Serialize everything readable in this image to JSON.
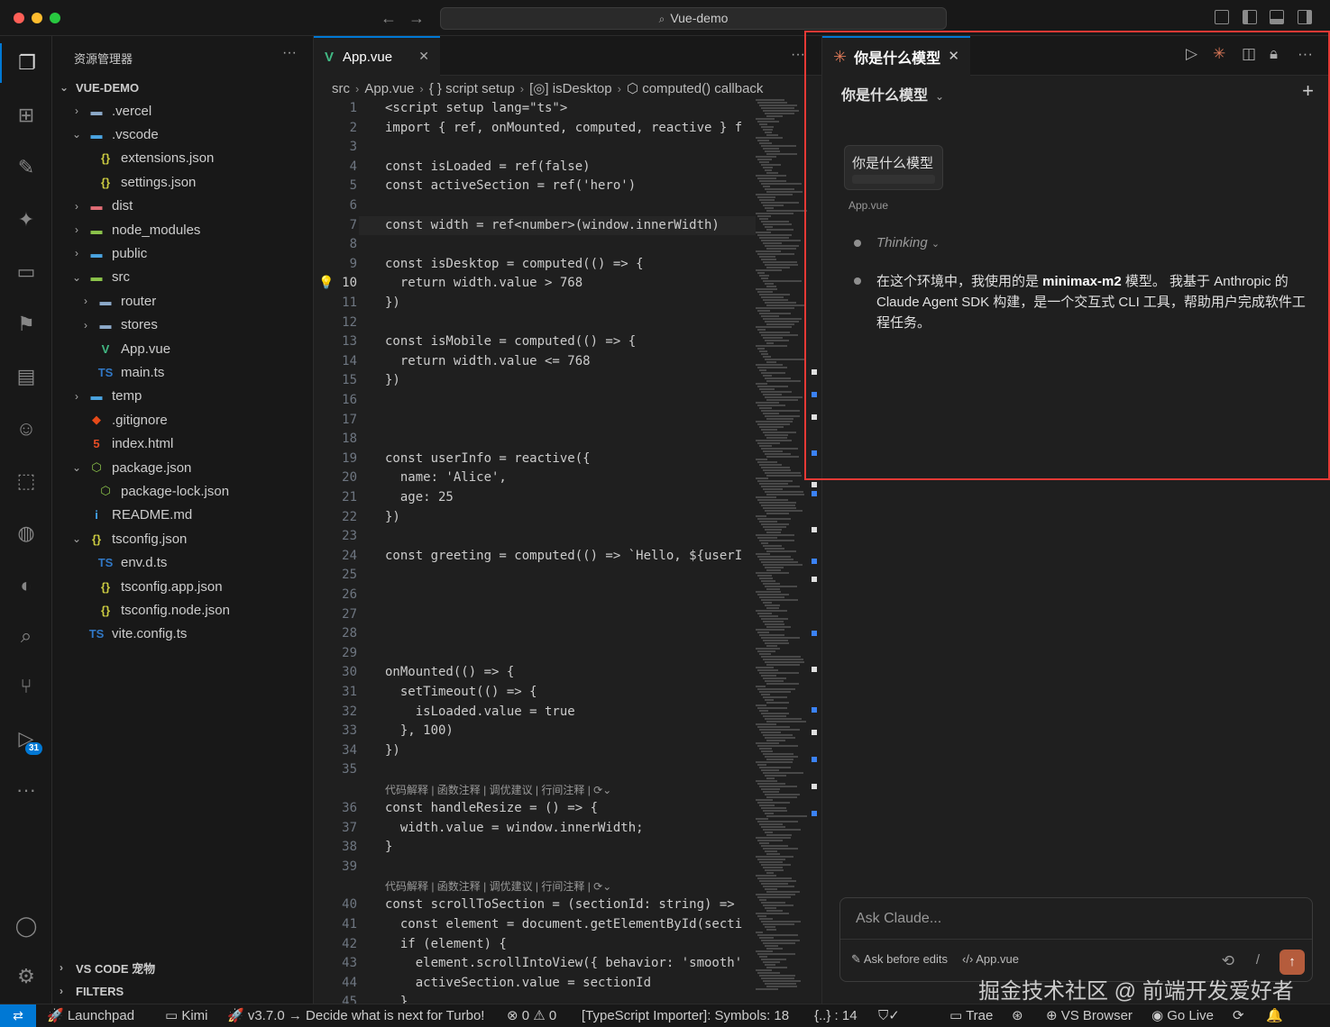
{
  "window": {
    "title": "Vue-demo"
  },
  "colors": {
    "accent": "#0078d4",
    "claude": "#d97757",
    "annotation_box": "#e53935",
    "vue_green": "#41b883"
  },
  "activity_bar": {
    "icons": [
      "explorer-icon",
      "extensions-icon",
      "paint-icon",
      "sparkle-icon",
      "remote-icon",
      "bookmark-icon",
      "notebook-icon",
      "copilot-icon",
      "container-icon",
      "python-icon",
      "github-icon",
      "search-icon",
      "source-control-icon",
      "run-debug-icon",
      "more-icon",
      "account-icon",
      "settings-icon"
    ],
    "badge": "31"
  },
  "sidebar": {
    "title": "资源管理器",
    "more": "···",
    "root": "VUE-DEMO",
    "items": [
      {
        "label": ".vercel",
        "chev": "›",
        "icon": "▬",
        "color": "#8ca9c9",
        "indent": 1
      },
      {
        "label": ".vscode",
        "chev": "⌄",
        "icon": "▬",
        "color": "#4aa3e0",
        "indent": 1
      },
      {
        "label": "extensions.json",
        "chev": "",
        "icon": "{}",
        "color": "#cbcb41",
        "indent": 2
      },
      {
        "label": "settings.json",
        "chev": "",
        "icon": "{}",
        "color": "#cbcb41",
        "indent": 2
      },
      {
        "label": "dist",
        "chev": "›",
        "icon": "▬",
        "color": "#e06c75",
        "indent": 1
      },
      {
        "label": "node_modules",
        "chev": "›",
        "icon": "▬",
        "color": "#8bc34a",
        "indent": 1
      },
      {
        "label": "public",
        "chev": "›",
        "icon": "▬",
        "color": "#4aa3e0",
        "indent": 1
      },
      {
        "label": "src",
        "chev": "⌄",
        "icon": "▬",
        "color": "#8bc34a",
        "indent": 1
      },
      {
        "label": "router",
        "chev": "›",
        "icon": "▬",
        "color": "#8ca9c9",
        "indent": 2
      },
      {
        "label": "stores",
        "chev": "›",
        "icon": "▬",
        "color": "#8ca9c9",
        "indent": 2
      },
      {
        "label": "App.vue",
        "chev": "",
        "icon": "V",
        "color": "#41b883",
        "indent": 2
      },
      {
        "label": "main.ts",
        "chev": "",
        "icon": "TS",
        "color": "#3178c6",
        "indent": 2
      },
      {
        "label": "temp",
        "chev": "›",
        "icon": "▬",
        "color": "#4aa3e0",
        "indent": 1
      },
      {
        "label": ".gitignore",
        "chev": "",
        "icon": "◆",
        "color": "#e64a19",
        "indent": 1
      },
      {
        "label": "index.html",
        "chev": "",
        "icon": "5",
        "color": "#e44d26",
        "indent": 1
      },
      {
        "label": "package.json",
        "chev": "⌄",
        "icon": "⬡",
        "color": "#8bc34a",
        "indent": 1
      },
      {
        "label": "package-lock.json",
        "chev": "",
        "icon": "⬡",
        "color": "#8bc34a",
        "indent": 2
      },
      {
        "label": "README.md",
        "chev": "",
        "icon": "i",
        "color": "#42a5f5",
        "indent": 1
      },
      {
        "label": "tsconfig.json",
        "chev": "⌄",
        "icon": "{}",
        "color": "#cbcb41",
        "indent": 1
      },
      {
        "label": "env.d.ts",
        "chev": "",
        "icon": "TS",
        "color": "#3178c6",
        "indent": 2
      },
      {
        "label": "tsconfig.app.json",
        "chev": "",
        "icon": "{}",
        "color": "#cbcb41",
        "indent": 2
      },
      {
        "label": "tsconfig.node.json",
        "chev": "",
        "icon": "{}",
        "color": "#cbcb41",
        "indent": 2
      },
      {
        "label": "vite.config.ts",
        "chev": "",
        "icon": "TS",
        "color": "#3178c6",
        "indent": 1
      }
    ],
    "sections": [
      "VS CODE 宠物",
      "FILTERS"
    ]
  },
  "editor": {
    "tab": {
      "label": "App.vue"
    },
    "more": "···",
    "breadcrumb": [
      "src",
      "App.vue",
      "{ } script setup",
      "[◎] isDesktop",
      "⬡ computed() callback"
    ],
    "current_line": "10",
    "lens_text": "代码解释 | 函数注释 | 调优建议 | 行间注释 | ⟳⌄",
    "lines": [
      {
        "n": "1",
        "t": "<script setup lang=\"ts\">"
      },
      {
        "n": "2",
        "t": "import { ref, onMounted, computed, reactive } f"
      },
      {
        "n": "3",
        "t": ""
      },
      {
        "n": "4",
        "t": "const isLoaded = ref(false)"
      },
      {
        "n": "5",
        "t": "const activeSection = ref('hero')"
      },
      {
        "n": "6",
        "t": ""
      },
      {
        "n": "7",
        "t": "const width = ref<number>(window.innerWidth)"
      },
      {
        "n": "8",
        "t": ""
      },
      {
        "n": "9",
        "t": "const isDesktop = computed(() => {"
      },
      {
        "n": "10",
        "t": "  return width.value > 768"
      },
      {
        "n": "11",
        "t": "})"
      },
      {
        "n": "12",
        "t": ""
      },
      {
        "n": "13",
        "t": "const isMobile = computed(() => {"
      },
      {
        "n": "14",
        "t": "  return width.value <= 768"
      },
      {
        "n": "15",
        "t": "})"
      },
      {
        "n": "16",
        "t": ""
      },
      {
        "n": "17",
        "t": ""
      },
      {
        "n": "18",
        "t": ""
      },
      {
        "n": "19",
        "t": "const userInfo = reactive({"
      },
      {
        "n": "20",
        "t": "  name: 'Alice',"
      },
      {
        "n": "21",
        "t": "  age: 25"
      },
      {
        "n": "22",
        "t": "})"
      },
      {
        "n": "23",
        "t": ""
      },
      {
        "n": "24",
        "t": "const greeting = computed(() => `Hello, ${userI"
      },
      {
        "n": "25",
        "t": ""
      },
      {
        "n": "26",
        "t": ""
      },
      {
        "n": "27",
        "t": ""
      },
      {
        "n": "28",
        "t": ""
      },
      {
        "n": "29",
        "t": ""
      },
      {
        "n": "30",
        "t": "onMounted(() => {"
      },
      {
        "n": "31",
        "t": "  setTimeout(() => {"
      },
      {
        "n": "32",
        "t": "    isLoaded.value = true"
      },
      {
        "n": "33",
        "t": "  }, 100)"
      },
      {
        "n": "34",
        "t": "})"
      },
      {
        "n": "35",
        "t": ""
      },
      {
        "n": "36",
        "t": "const handleResize = () => {"
      },
      {
        "n": "37",
        "t": "  width.value = window.innerWidth;"
      },
      {
        "n": "38",
        "t": "}"
      },
      {
        "n": "39",
        "t": ""
      },
      {
        "n": "40",
        "t": "const scrollToSection = (sectionId: string) =>"
      },
      {
        "n": "41",
        "t": "  const element = document.getElementById(secti"
      },
      {
        "n": "42",
        "t": "  if (element) {"
      },
      {
        "n": "43",
        "t": "    element.scrollIntoView({ behavior: 'smooth'"
      },
      {
        "n": "44",
        "t": "    activeSection.value = sectionId"
      },
      {
        "n": "45",
        "t": "  }"
      }
    ]
  },
  "claude_panel": {
    "tab_label": "你是什么模型",
    "conversation_title": "你是什么模型",
    "new_chat": "+",
    "user_message": "你是什么模型",
    "attachment": "App.vue",
    "thinking": "Thinking",
    "answer_pre": "在这个环境中，我使用的是 ",
    "answer_model": "minimax-m2",
    "answer_post": " 模型。 我基于 Anthropic 的 Claude Agent SDK 构建，是一个交互式 CLI 工具，帮助用户完成软件工程任务。",
    "input_placeholder": "Ask Claude...",
    "mode": "Ask before edits",
    "context_file": "App.vue",
    "slash": "/"
  },
  "watermark": "掘金技术社区 @ 前端开发爱好者",
  "status_bar": {
    "remote": "⇄",
    "items": [
      {
        "text": "🚀 Launchpad"
      },
      {
        "text": "▭ Kimi"
      },
      {
        "text": "🚀 v3.7.0 → Decide what is next for Turbo!"
      },
      {
        "text": "⊗ 0 ⚠ 0"
      },
      {
        "text": "[TypeScript Importer]: Symbols: 18"
      },
      {
        "text": "{..} : 14"
      },
      {
        "text": "⛉✓"
      }
    ],
    "right_items": [
      {
        "text": "▭ Trae"
      },
      {
        "text": "⊛"
      },
      {
        "text": "⊕ VS Browser"
      },
      {
        "text": "◉ Go Live"
      },
      {
        "text": "⟳"
      },
      {
        "text": "🔔"
      }
    ]
  }
}
